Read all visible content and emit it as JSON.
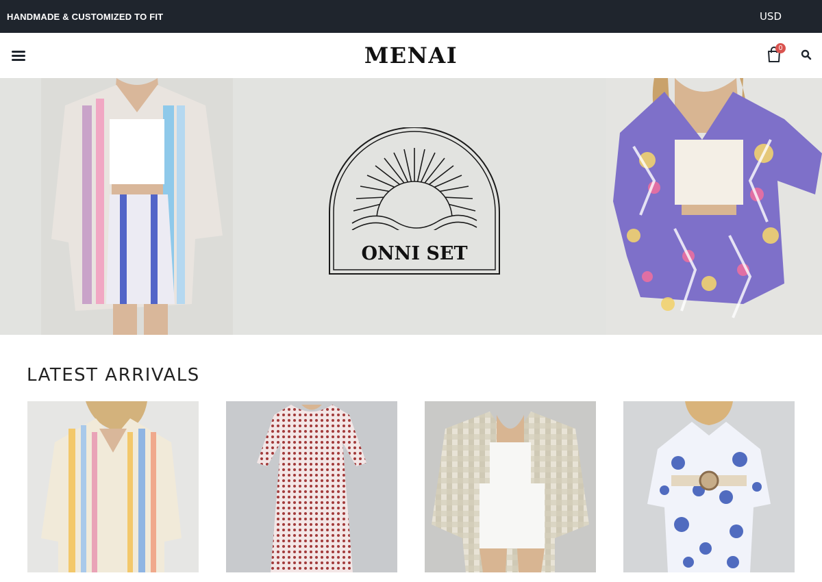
{
  "topbar": {
    "announcement": "HANDMADE & CUSTOMIZED TO FIT",
    "currency": "USD"
  },
  "header": {
    "logo": "MENAI",
    "cart_count": "0",
    "icons": [
      "menu-icon",
      "cart-icon",
      "search-icon"
    ]
  },
  "hero": {
    "emblem_text": "ONNI SET"
  },
  "latest": {
    "title": "LATEST ARRIVALS",
    "products": [
      {
        "desc": "striped pastel shirt and shorts set"
      },
      {
        "desc": "red and white patterned maxi dress"
      },
      {
        "desc": "beige check shirt with white shorts"
      },
      {
        "desc": "blue toile print shirt and shorts set"
      }
    ]
  },
  "colors": {
    "topbar_bg": "#1f252d",
    "cart_badge": "#d9534f",
    "hero_bg": "#e2e3e0"
  }
}
